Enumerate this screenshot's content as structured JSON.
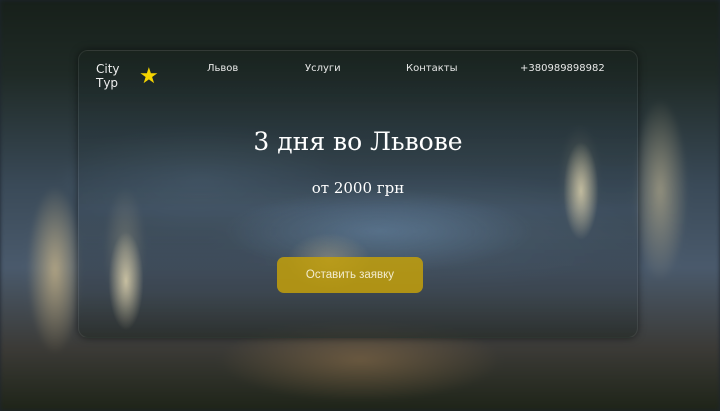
{
  "logo": {
    "line1": "City",
    "line2": "Тур",
    "icon": "star-icon",
    "star_color": "#f5d400"
  },
  "nav": {
    "items": [
      "Львов",
      "Услуги",
      "Контакты"
    ],
    "phone": "+380989898982"
  },
  "hero": {
    "title": "3 дня во Львове",
    "price": "от 2000 грн",
    "cta": "Оставить заявку",
    "cta_color": "#c3a00a"
  }
}
